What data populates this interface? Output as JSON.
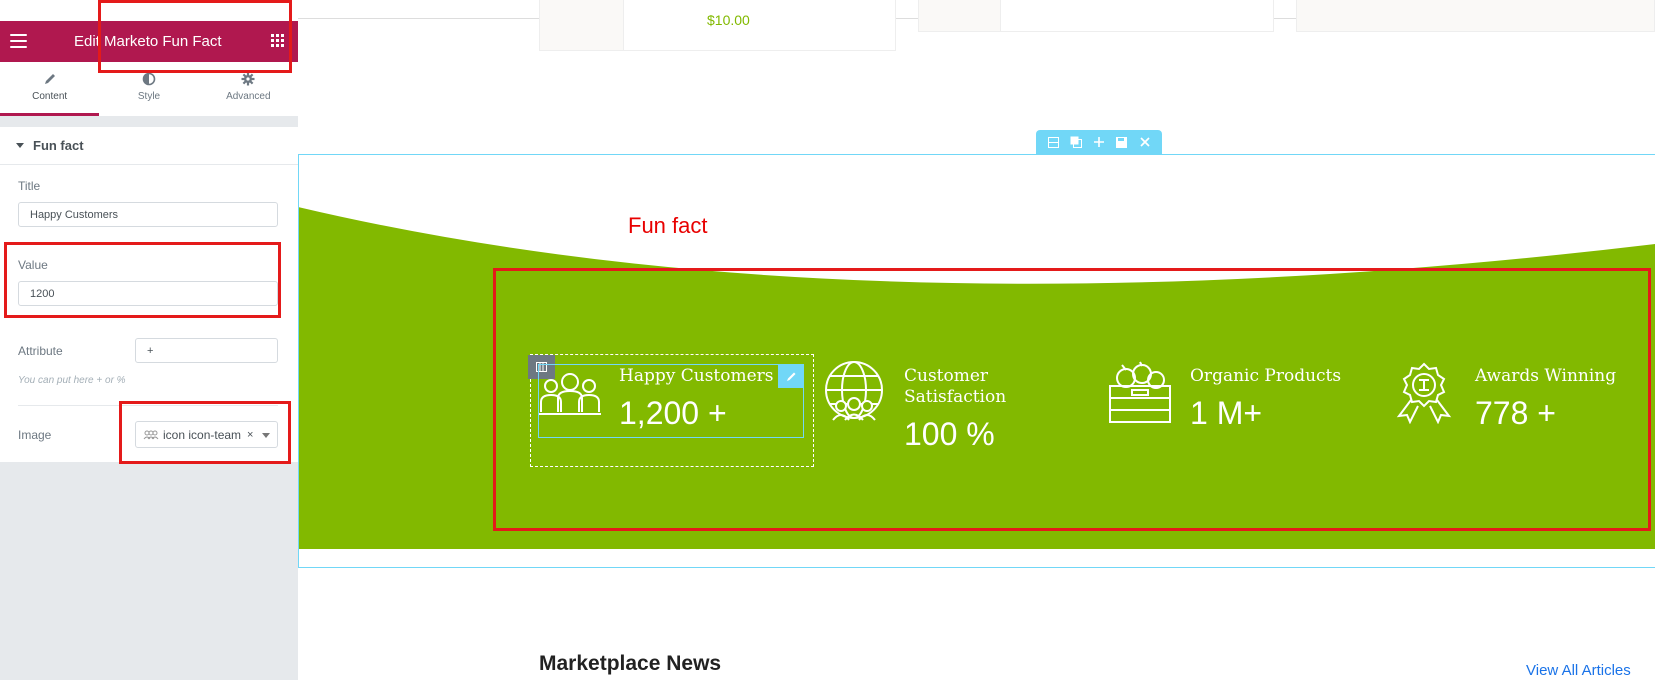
{
  "editor": {
    "header_title": "Edit Marketo Fun Fact",
    "tabs": [
      {
        "label": "Content",
        "icon": "pencil-icon"
      },
      {
        "label": "Style",
        "icon": "half-circle-icon"
      },
      {
        "label": "Advanced",
        "icon": "gear-icon"
      }
    ],
    "section_title": "Fun fact",
    "controls": {
      "title_label": "Title",
      "title_value": "Happy Customers",
      "value_label": "Value",
      "value_value": "1200",
      "attribute_label": "Attribute",
      "attribute_value": "+",
      "attribute_help": "You can put here + or %",
      "image_label": "Image",
      "image_value": "icon icon-team",
      "image_clear": "×"
    },
    "accent_color": "#b0184f"
  },
  "canvas": {
    "price": "$10.00",
    "annotation_label": "Fun fact",
    "section_toolbar": [
      "columns-icon",
      "duplicate-icon",
      "plus-icon",
      "save-icon",
      "close-icon"
    ],
    "green_color": "#82b900",
    "facts": [
      {
        "title": "Happy Customers",
        "value": "1,200 +",
        "icon": "team-icon"
      },
      {
        "title": "Customer Satisfaction",
        "value": "100 %",
        "icon": "globe-people-icon"
      },
      {
        "title": "Organic Products",
        "value": "1 M+",
        "icon": "produce-crate-icon"
      },
      {
        "title": "Awards Winning",
        "value": "778 +",
        "icon": "award-medal-icon"
      }
    ],
    "news_title": "Marketplace News",
    "news_link": "View All Articles"
  }
}
